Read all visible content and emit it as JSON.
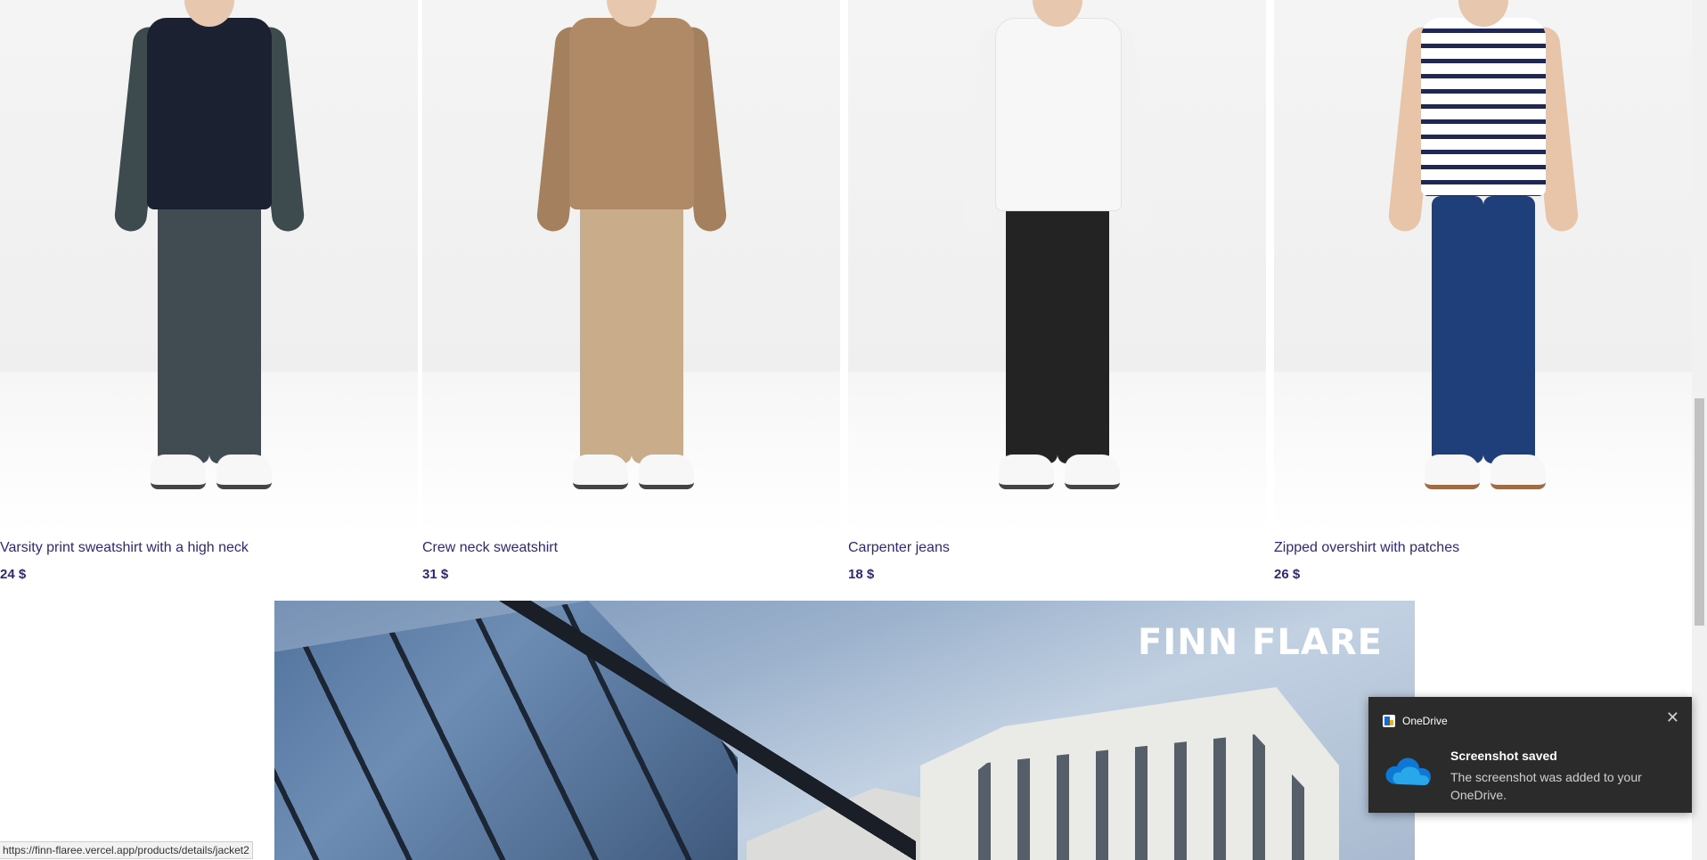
{
  "products": [
    {
      "name": "Varsity print sweatshirt with a high neck",
      "price": "24 $"
    },
    {
      "name": "Crew neck sweatshirt",
      "price": "31 $"
    },
    {
      "name": "Carpenter jeans",
      "price": "18 $"
    },
    {
      "name": "Zipped overshirt with patches",
      "price": "26 $"
    }
  ],
  "banner": {
    "logo_text": "FINN FLARE"
  },
  "status_bar": {
    "url": "https://finn-flaree.vercel.app/products/details/jacket2"
  },
  "toast": {
    "app_name": "OneDrive",
    "title": "Screenshot saved",
    "message": "The screenshot was added to your OneDrive.",
    "close_icon": "close-icon"
  },
  "colors": {
    "link": "#2d2a73",
    "toast_bg": "#2b2b2b",
    "onedrive_blue": "#0f78d4"
  }
}
